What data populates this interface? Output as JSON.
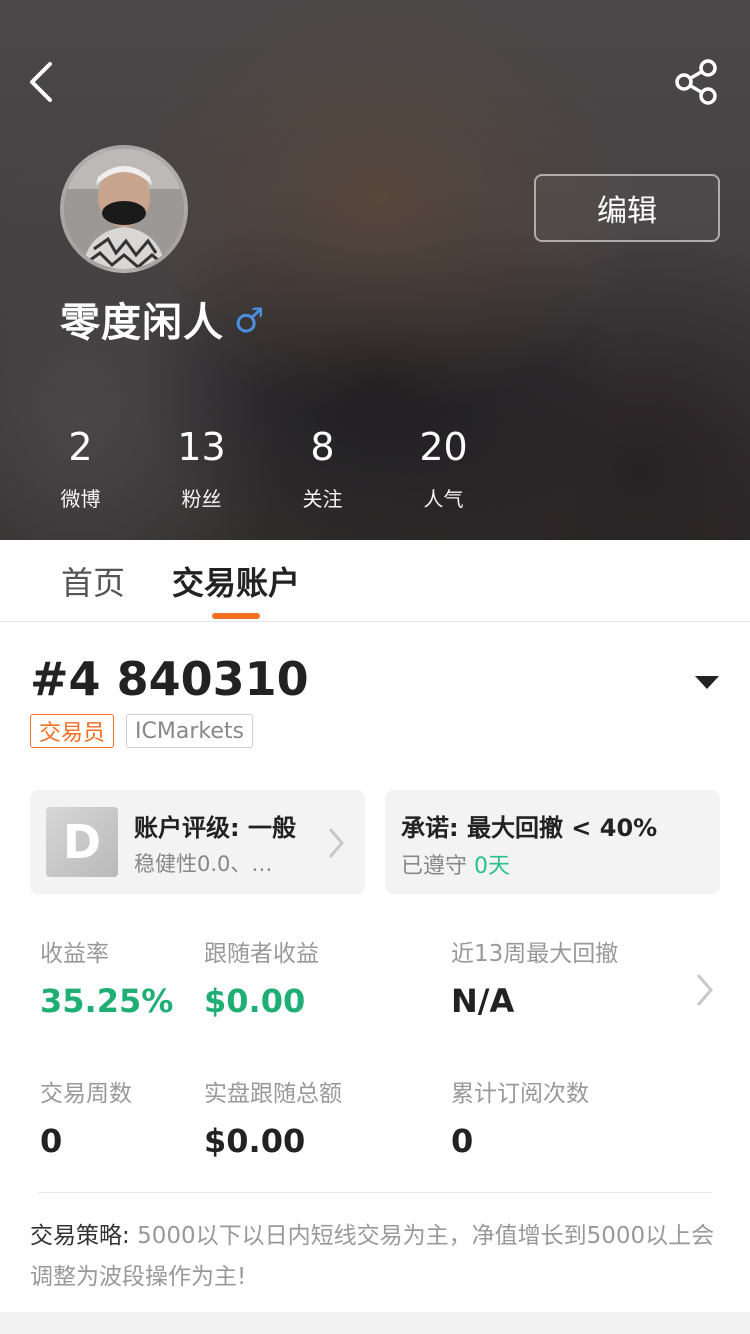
{
  "header": {
    "back_icon": "chevron-left-icon",
    "share_icon": "share-icon",
    "edit_label": "编辑",
    "username": "零度闲人",
    "gender_symbol": "♂",
    "stats": [
      {
        "value": "2",
        "label": "微博"
      },
      {
        "value": "13",
        "label": "粉丝"
      },
      {
        "value": "8",
        "label": "关注"
      },
      {
        "value": "20",
        "label": "人气"
      }
    ]
  },
  "tabs": [
    {
      "label": "首页",
      "active": false
    },
    {
      "label": "交易账户",
      "active": true
    }
  ],
  "account": {
    "id": "#4 840310",
    "role_badge": "交易员",
    "broker_badge": "ICMarkets"
  },
  "rating_card": {
    "grade": "D",
    "title": "账户评级: 一般",
    "subtitle": "稳健性0.0、…"
  },
  "promise_card": {
    "title": "承诺: 最大回撤 < 40%",
    "status_label": "已遵守",
    "days": "0天"
  },
  "metrics": [
    {
      "label": "收益率",
      "value": "35.25%"
    },
    {
      "label": "跟随者收益",
      "value": "$0.00"
    },
    {
      "label": "近13周最大回撤",
      "value": "N/A"
    },
    {
      "label": "交易周数",
      "value": "0"
    },
    {
      "label": "实盘跟随总额",
      "value": "$0.00"
    },
    {
      "label": "累计订阅次数",
      "value": "0"
    }
  ],
  "strategy": {
    "label": "交易策略:",
    "text": "5000以下以日内短线交易为主，净值增长到5000以上会调整为波段操作为主!"
  },
  "colors": {
    "accent": "#f36f22",
    "green": "#1faf74",
    "promise_green": "#29c08a",
    "gender_blue": "#4a90e2"
  }
}
